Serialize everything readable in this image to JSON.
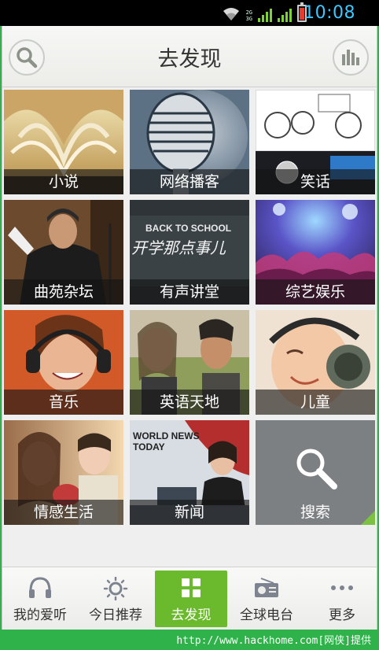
{
  "status_bar": {
    "time": "10:08",
    "network_label_1": "2G",
    "network_label_2": "3G"
  },
  "header": {
    "title": "去发现",
    "left_button_icon": "search-icon",
    "right_button_icon": "bar-chart-icon"
  },
  "tiles": [
    {
      "label": "小说",
      "icon": "book-image"
    },
    {
      "label": "网络播客",
      "icon": "microphone-image"
    },
    {
      "label": "笑话",
      "icon": "comic-image"
    },
    {
      "label": "曲苑杂坛",
      "icon": "performer-image"
    },
    {
      "label": "有声讲堂",
      "icon": "classroom-image"
    },
    {
      "label": "综艺娱乐",
      "icon": "concert-image"
    },
    {
      "label": "音乐",
      "icon": "headphones-woman-image"
    },
    {
      "label": "英语天地",
      "icon": "conversation-image"
    },
    {
      "label": "儿童",
      "icon": "baby-headphones-image"
    },
    {
      "label": "情感生活",
      "icon": "couple-image"
    },
    {
      "label": "新闻",
      "icon": "news-anchor-image"
    },
    {
      "label": "搜索",
      "icon": "search-icon"
    }
  ],
  "tile_art_text": {
    "classroom": "BACK TO SCHOOL",
    "classroom_sub": "开学那点事儿",
    "news_header_1": "WORLD NEWS",
    "news_header_2": "TODAY"
  },
  "bottom_nav": [
    {
      "label": "我的爱听",
      "icon": "headphones-icon",
      "active": false
    },
    {
      "label": "今日推荐",
      "icon": "sun-icon",
      "active": false
    },
    {
      "label": "去发现",
      "icon": "grid-icon",
      "active": true
    },
    {
      "label": "全球电台",
      "icon": "radio-icon",
      "active": false
    },
    {
      "label": "更多",
      "icon": "more-dots-icon",
      "active": false
    }
  ],
  "watermark": "http://www.hackhome.com[网侠]提供",
  "colors": {
    "accent_green": "#6bb92d",
    "status_blue": "#3cc7ff",
    "corner_green": "#7cc142",
    "footer_green": "#2fb24a"
  }
}
